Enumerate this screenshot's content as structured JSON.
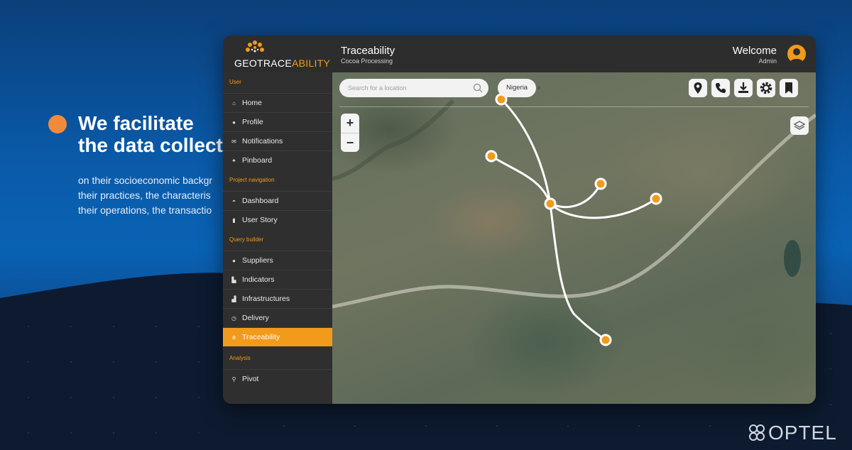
{
  "slide": {
    "headline_line1": "We facilitate",
    "headline_line2": "the data collect",
    "body_lines": [
      "on their socioeconomic backgr",
      "their practices, the characteris",
      "their operations, the transactio"
    ],
    "accent_color": "#f28a3c"
  },
  "app": {
    "brand": {
      "part1": "GEOTRACE",
      "part2": "ABILITY",
      "accent": "#f29a1c"
    },
    "header": {
      "title": "Traceability",
      "subtitle": "Cocoa Processing",
      "welcome": "Welcome",
      "role": "Admin"
    },
    "sidebar": {
      "sections": [
        {
          "label": "User",
          "items": [
            {
              "label": "Home",
              "icon": "home-icon"
            },
            {
              "label": "Profile",
              "icon": "user-icon"
            },
            {
              "label": "Notifications",
              "icon": "mail-icon"
            },
            {
              "label": "Pinboard",
              "icon": "pin-icon"
            }
          ]
        },
        {
          "label": "Project navigation",
          "items": [
            {
              "label": "Dashboard",
              "icon": "dashboard-icon"
            },
            {
              "label": "User Story",
              "icon": "bookmark-icon"
            }
          ]
        },
        {
          "label": "Query builder",
          "items": [
            {
              "label": "Suppliers",
              "icon": "user-icon"
            },
            {
              "label": "Indicators",
              "icon": "chart-icon"
            },
            {
              "label": "Infrastructures",
              "icon": "factory-icon"
            },
            {
              "label": "Delivery",
              "icon": "clock-icon"
            },
            {
              "label": "Traceability",
              "icon": "traceability-icon",
              "active": true
            }
          ]
        },
        {
          "label": "Analysis",
          "items": [
            {
              "label": "Pivot",
              "icon": "location-icon"
            }
          ]
        }
      ]
    },
    "map": {
      "search_placeholder": "Search for a location",
      "breadcrumb": "Nigeria",
      "toolbar": [
        "location-pin-icon",
        "phone-icon",
        "download-icon",
        "gear-icon",
        "bookmark-icon"
      ],
      "zoom_in": "+",
      "zoom_out": "−",
      "route_color": "#ffffff",
      "node_color": "#f29a1c"
    }
  },
  "watermark": "OPTEL"
}
